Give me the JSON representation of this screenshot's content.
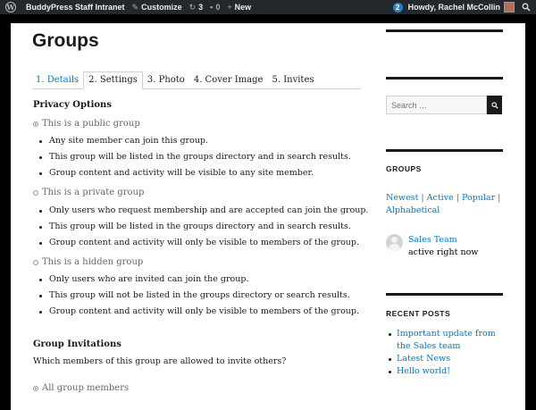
{
  "adminbar": {
    "site_name": "BuddyPress Staff Intranet",
    "customize": "Customize",
    "comments_count": "3",
    "new_comments": "0",
    "new_label": "New",
    "notifications": "2",
    "howdy": "Howdy, Rachel McCollin"
  },
  "page": {
    "title": "Groups",
    "tabs": [
      "1. Details",
      "2. Settings",
      "3. Photo",
      "4. Cover Image",
      "5. Invites"
    ],
    "active_tab": "2. Settings"
  },
  "privacy": {
    "heading": "Privacy Options",
    "options": [
      {
        "label": "This is a public group",
        "selected": true,
        "bullets": [
          "Any site member can join this group.",
          "This group will be listed in the groups directory and in search results.",
          "Group content and activity will be visible to any site member."
        ]
      },
      {
        "label": "This is a private group",
        "selected": false,
        "bullets": [
          "Only users who request membership and are accepted can join the group.",
          "This group will be listed in the groups directory and in search results.",
          "Group content and activity will only be visible to members of the group."
        ]
      },
      {
        "label": "This is a hidden group",
        "selected": false,
        "bullets": [
          "Only users who are invited can join the group.",
          "This group will not be listed in the groups directory or search results.",
          "Group content and activity will only be visible to members of the group."
        ]
      }
    ]
  },
  "invitations": {
    "heading": "Group Invitations",
    "question": "Which members of this group are allowed to invite others?",
    "option": "All group members",
    "option_selected": true
  },
  "sidebar": {
    "search_placeholder": "Search …",
    "groups_title": "GROUPS",
    "group_filters": [
      "Newest",
      "Active",
      "Popular",
      "Alphabetical"
    ],
    "group_separator": "|",
    "member_name": "Sales Team",
    "member_status": "active right now",
    "recent_title": "RECENT POSTS",
    "recent_posts": [
      "Important update from the Sales team",
      "Latest News",
      "Hello world!"
    ]
  },
  "colors": {
    "link": "#007acc",
    "adminbar": "#23282d",
    "text": "#1a1a1a",
    "muted": "#686868"
  },
  "icons": [
    "wordpress-icon",
    "pencil-icon",
    "comments-icon",
    "speech-bubble-icon",
    "plus-icon",
    "notification-badge",
    "avatar",
    "search-icon"
  ]
}
